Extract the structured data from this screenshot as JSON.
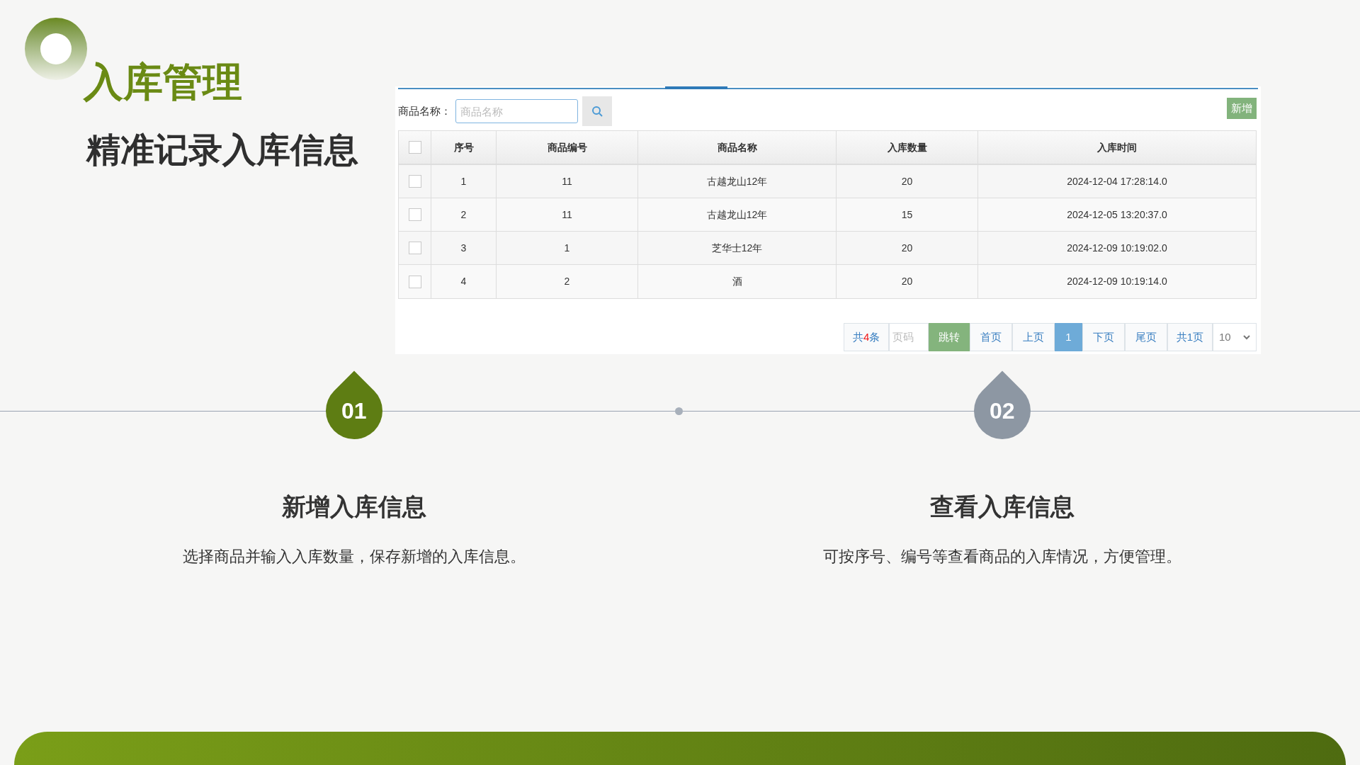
{
  "slide": {
    "title": "入库管理",
    "subtitle": "精准记录入库信息"
  },
  "search": {
    "label": "商品名称：",
    "placeholder": "商品名称"
  },
  "add_button": "新增",
  "table": {
    "header_checked": false,
    "columns": [
      "序号",
      "商品编号",
      "商品名称",
      "入库数量",
      "入库时间"
    ],
    "rows": [
      {
        "checked": false,
        "cells": [
          "1",
          "11",
          "古越龙山12年",
          "20",
          "2024-12-04 17:28:14.0"
        ]
      },
      {
        "checked": false,
        "cells": [
          "2",
          "11",
          "古越龙山12年",
          "15",
          "2024-12-05 13:20:37.0"
        ]
      },
      {
        "checked": false,
        "cells": [
          "3",
          "1",
          "芝华士12年",
          "20",
          "2024-12-09 10:19:02.0"
        ]
      },
      {
        "checked": false,
        "cells": [
          "4",
          "2",
          "酒",
          "20",
          "2024-12-09 10:19:14.0"
        ]
      }
    ]
  },
  "pagination": {
    "total_prefix": "共",
    "total_count": "4",
    "total_suffix": "条",
    "page_placeholder": "页码",
    "go": "跳转",
    "buttons": [
      {
        "label": "首页",
        "selected": false
      },
      {
        "label": "上页",
        "selected": false
      },
      {
        "label": "1",
        "selected": true
      },
      {
        "label": "下页",
        "selected": false
      },
      {
        "label": "尾页",
        "selected": false
      }
    ],
    "page_count": "共1页",
    "page_size": "10"
  },
  "steps": [
    {
      "number": "01",
      "title": "新增入库信息",
      "description": "选择商品并输入入库数量，保存新增的入库信息。",
      "color": "#5e7d13"
    },
    {
      "number": "02",
      "title": "查看入库信息",
      "description": "可按序号、编号等查看商品的入库情况，方便管理。",
      "color": "#8d97a3"
    }
  ]
}
